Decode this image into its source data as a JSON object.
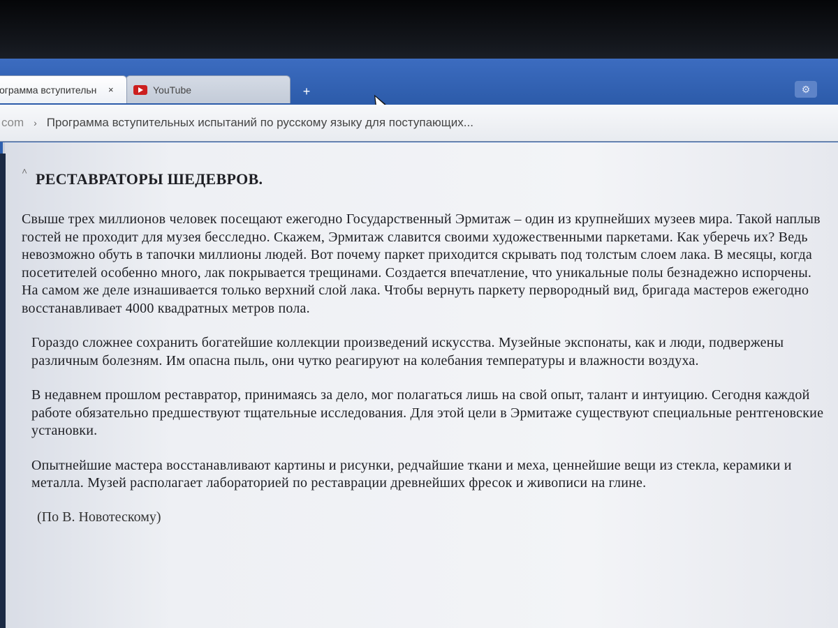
{
  "browser": {
    "tabs": [
      {
        "label": "ограмма вступительн",
        "close": "×"
      },
      {
        "label": "YouTube",
        "icon": "youtube-icon"
      }
    ],
    "new_tab": "+",
    "address": {
      "domain": "com",
      "separator": "›",
      "title": "Программа вступительных испытаний по русскому языку для поступающих..."
    }
  },
  "article": {
    "heading": "РЕСТАВРАТОРЫ ШЕДЕВРОВ.",
    "paragraphs": [
      "Свыше трех миллионов человек посещают ежегодно Государственный Эрмитаж – один из крупнейших музеев мира. Такой наплыв гостей не проходит для музея бесследно. Скажем, Эрмитаж славится своими художественными паркетами. Как уберечь их? Ведь невозможно обуть в тапочки миллионы людей. Вот почему паркет приходится скрывать под толстым слоем лака. В месяцы, когда посетителей особенно много, лак покрывается трещинами. Создается впечатление, что уникальные полы безнадежно испорчены. На самом же деле изнашивается только верхний слой лака. Чтобы вернуть паркету первородный вид, бригада мастеров ежегодно восстанавливает 4000 квадратных метров пола.",
      "Гораздо сложнее сохранить богатейшие коллекции произведений искусства. Музейные экспонаты, как и люди, подвержены различным болезням. Им опасна пыль, они чутко реагируют на колебания температуры и влажности воздуха.",
      "В недавнем прошлом реставратор, принимаясь за дело, мог полагаться лишь на свой опыт, талант и интуицию. Сегодня каждой работе обязательно предшествуют тщательные исследования. Для этой цели в Эрмитаже существуют специальные рентгеновские установки.",
      "Опытнейшие мастера восстанавливают картины и рисунки, редчайшие ткани и меха, ценнейшие вещи из стекла, керамики и металла. Музей располагает лабораторией по реставрации древнейших фресок и живописи на глине."
    ],
    "source": "(По В. Новотескому)"
  }
}
